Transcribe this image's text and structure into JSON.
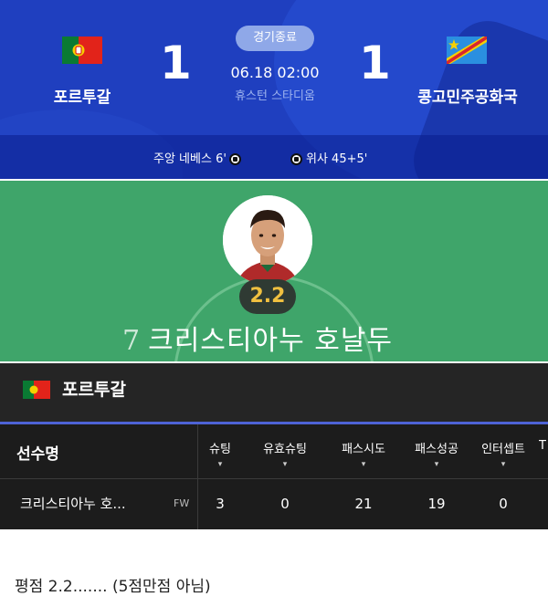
{
  "match": {
    "status_badge": "경기종료",
    "home_team": "포르투갈",
    "away_team": "콩고민주공화국",
    "home_score": "1",
    "away_score": "1",
    "datetime": "06.18 02:00",
    "stadium": "휴스턴 스타디움",
    "home_scorer": "주앙 네베스 6'",
    "away_scorer": "위사 45+5'",
    "colors": {
      "background": "#1f3fbf",
      "badge": "#8fa8e8"
    }
  },
  "player": {
    "number": "7",
    "name": "크리스티아누 호날두",
    "rating": "2.2",
    "colors": {
      "card": "#3fa56a",
      "rating_text": "#f0c040"
    }
  },
  "team_section": {
    "team": "포르투갈"
  },
  "stats_table": {
    "name_header": "선수명",
    "columns": [
      "슈팅",
      "유효슈팅",
      "패스시도",
      "패스성공",
      "인터셉트",
      "T"
    ],
    "sort_icon": "▾",
    "rows": [
      {
        "name": "크리스티아누 호...",
        "position": "FW",
        "values": [
          "3",
          "0",
          "21",
          "19",
          "0"
        ]
      }
    ]
  },
  "caption": "평점 2.2....... (5점만점 아님)"
}
